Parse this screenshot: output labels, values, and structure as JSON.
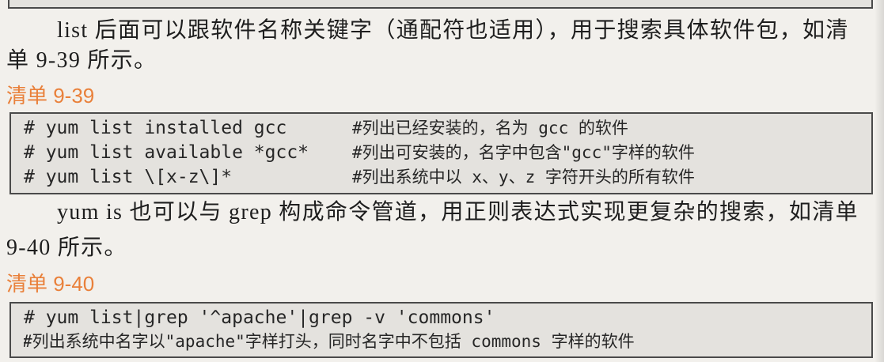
{
  "paragraphs": [
    {
      "lines": [
        "list 后面可以跟软件名称关键字（通配符也适用），用于搜索具体软件包，如清",
        "单 9-39 所示。"
      ]
    },
    {
      "lines": [
        "yum is 也可以与 grep 构成命令管道，用正则表达式实现更复杂的搜索，如清单",
        "9-40 所示。"
      ]
    }
  ],
  "listings": [
    {
      "title": "清单 9-39",
      "lines": [
        {
          "code": "# yum list installed gcc",
          "comment": "#列出已经安装的，名为 gcc 的软件"
        },
        {
          "code": "# yum list available *gcc*",
          "comment": "#列出可安装的，名字中包含\"gcc\"字样的软件"
        },
        {
          "code": "# yum list \\[x-z\\]*",
          "comment": "#列出系统中以 x、y、z 字符开头的所有软件"
        }
      ]
    },
    {
      "title": "清单 9-40",
      "command": "# yum list|grep '^apache'|grep -v 'commons'",
      "comment": "#列出系统中名字以\"apache\"字样打头，同时名字中不包括 commons 字样的软件"
    }
  ],
  "colors": {
    "page_background": "#f2f0ec",
    "code_background": "#e4e2de",
    "code_border": "#4a4a4a",
    "text": "#1e1e1e",
    "listing_title": "#e9803a"
  }
}
